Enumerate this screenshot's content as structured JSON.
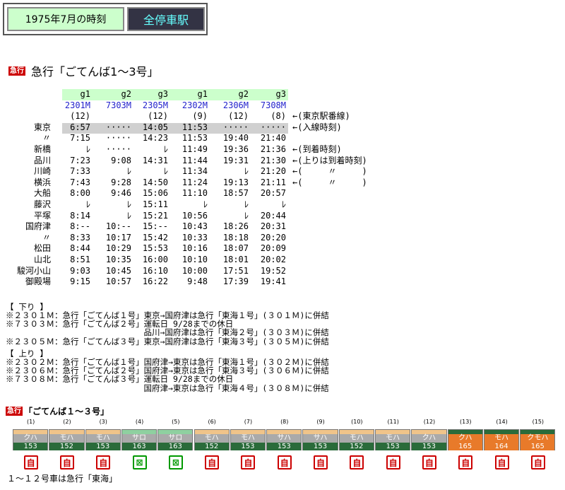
{
  "tabs": {
    "period": "1975年7月の時刻",
    "all_stations": "全停車駅"
  },
  "exp_label": "急行",
  "title": "急行「ごてんば1〜3号」",
  "header": {
    "groups": [
      "g1",
      "g2",
      "g3",
      "g1",
      "g2",
      "g3"
    ],
    "trains": [
      "2301M",
      "7303M",
      "2305M",
      "2302M",
      "2306M",
      "7308M"
    ],
    "tracks": [
      "(12)",
      "",
      "(12)",
      "(9)",
      "(12)",
      "(8)"
    ]
  },
  "stations": [
    "東京",
    "〃",
    "新橋",
    "品川",
    "川崎",
    "横浜",
    "大船",
    "藤沢",
    "平塚",
    "国府津",
    "〃",
    "松田",
    "山北",
    "駿河小山",
    "御殿場"
  ],
  "times": [
    [
      "6:57",
      "7:15",
      "ﾚ",
      "7:23",
      "7:33",
      "7:43",
      "8:00",
      "ﾚ",
      "8:14",
      "8:--",
      "8:33",
      "8:44",
      "8:51",
      "9:03",
      "9:15"
    ],
    [
      "·····",
      "·····",
      "·····",
      "9:08",
      "ﾚ",
      "9:28",
      "9:46",
      "ﾚ",
      "ﾚ",
      "10:--",
      "10:17",
      "10:29",
      "10:35",
      "10:45",
      "10:57"
    ],
    [
      "14:05",
      "14:23",
      "ﾚ",
      "14:31",
      "ﾚ",
      "14:50",
      "15:06",
      "15:11",
      "15:21",
      "15:--",
      "15:42",
      "15:53",
      "16:00",
      "16:10",
      "16:22"
    ],
    [
      "11:53",
      "11:53",
      "11:49",
      "11:44",
      "11:34",
      "11:24",
      "11:10",
      "ﾚ",
      "10:56",
      "10:43",
      "10:33",
      "10:16",
      "10:10",
      "10:00",
      "9:48"
    ],
    [
      "·····",
      "19:40",
      "19:36",
      "19:31",
      "ﾚ",
      "19:13",
      "18:57",
      "ﾚ",
      "ﾚ",
      "18:26",
      "18:18",
      "18:07",
      "18:01",
      "17:51",
      "17:39"
    ],
    [
      "·····",
      "21:40",
      "21:36",
      "21:30",
      "21:20",
      "21:11",
      "20:57",
      "ﾚ",
      "20:44",
      "20:31",
      "20:20",
      "20:09",
      "20:02",
      "19:52",
      "19:41"
    ]
  ],
  "annotations": [
    "←(東京駅番線)",
    "←(入線時刻)",
    "←(到着時刻)",
    "←(上りは到着時刻)",
    "←(　　　〃　　　)",
    "←(　　　〃　　　)"
  ],
  "notes": {
    "down_head": "【 下り 】",
    "down": [
      "※２３０１Ｍ：急行「ごてんば１号」東京→国府津は急行「東海１号」(３０１Ｍ)に併結",
      "※７３０３Ｍ：急行「ごてんば２号」運転日 9/28までの休日",
      "　　　　　　　　　　　　　　　　　品川→国府津は急行「東海２号」(３０３Ｍ)に併結",
      "※２３０５Ｍ：急行「ごてんば３号」東京→国府津は急行「東海３号」(３０５Ｍ)に併結"
    ],
    "up_head": "【 上り 】",
    "up": [
      "※２３０２Ｍ：急行「ごてんば１号」国府津→東京は急行「東海１号」(３０２Ｍ)に併結",
      "※２３０６Ｍ：急行「ごてんば２号」国府津→東京は急行「東海３号」(３０６Ｍ)に併結",
      "※７３０８Ｍ：急行「ごてんば３号」運転日 9/28までの休日",
      "　　　　　　　　　　　　　　　　　国府津→東京は急行「東海４号」(３０８Ｍ)に併結"
    ]
  },
  "consist_title": "「ごてんば１〜３号」",
  "cars": [
    {
      "pos": "(1)",
      "type": "クハ",
      "num": "153",
      "seat": "自"
    },
    {
      "pos": "(2)",
      "type": "モハ",
      "num": "152",
      "seat": "自"
    },
    {
      "pos": "(3)",
      "type": "モハ",
      "num": "153",
      "seat": "自"
    },
    {
      "pos": "(4)",
      "type": "サロ",
      "num": "163",
      "seat": "G"
    },
    {
      "pos": "(5)",
      "type": "サロ",
      "num": "163",
      "seat": "G"
    },
    {
      "pos": "(6)",
      "type": "モハ",
      "num": "152",
      "seat": "自"
    },
    {
      "pos": "(7)",
      "type": "モハ",
      "num": "153",
      "seat": "自"
    },
    {
      "pos": "(8)",
      "type": "サハ",
      "num": "153",
      "seat": "自"
    },
    {
      "pos": "(9)",
      "type": "サハ",
      "num": "153",
      "seat": "自"
    },
    {
      "pos": "(10)",
      "type": "モハ",
      "num": "152",
      "seat": "自"
    },
    {
      "pos": "(11)",
      "type": "モハ",
      "num": "153",
      "seat": "自"
    },
    {
      "pos": "(12)",
      "type": "クハ",
      "num": "153",
      "seat": "自"
    },
    {
      "pos": "(13)",
      "type": "クハ",
      "num": "165",
      "seat": "自"
    },
    {
      "pos": "(14)",
      "type": "モハ",
      "num": "164",
      "seat": "自"
    },
    {
      "pos": "(15)",
      "type": "クモハ",
      "num": "165",
      "seat": "自"
    }
  ],
  "consist_note": "１〜１２号車は急行「東海」",
  "colors": {
    "orange": "#e87a2a",
    "green": "#2a6b3a",
    "cream": "#f0c48a",
    "green_car": "#8fd0a0"
  }
}
